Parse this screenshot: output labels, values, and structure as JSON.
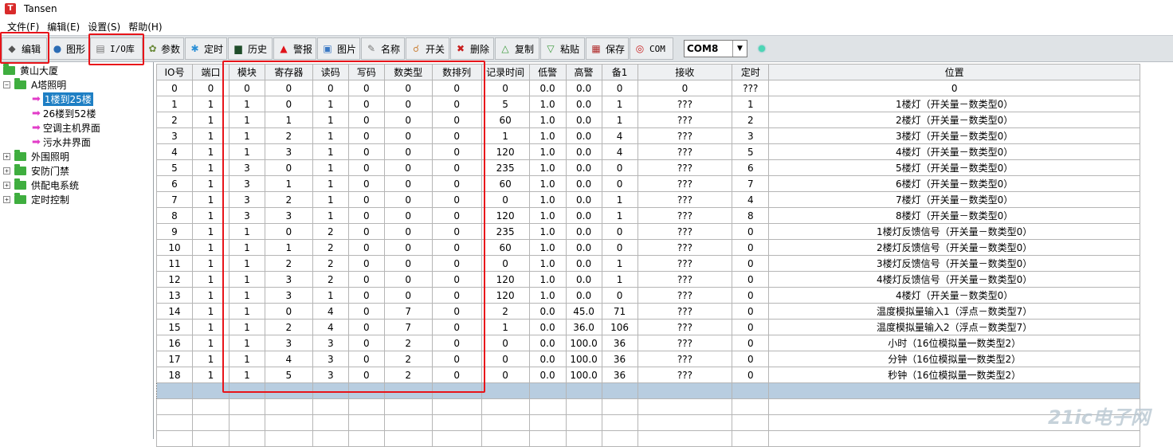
{
  "app": {
    "title": "Tansen",
    "icon_letter": "T"
  },
  "menu": [
    "文件(F)",
    "编辑(E)",
    "设置(S)",
    "帮助(H)"
  ],
  "toolbar": {
    "buttons": [
      {
        "label": "编辑",
        "icon": "edit-icon"
      },
      {
        "label": "图形",
        "icon": "graph-icon"
      },
      {
        "label": "I/O库",
        "icon": "io-library-icon"
      },
      {
        "label": "参数",
        "icon": "gear-icon"
      },
      {
        "label": "定时",
        "icon": "timer-icon"
      },
      {
        "label": "历史",
        "icon": "history-icon"
      },
      {
        "label": "警报",
        "icon": "alarm-icon"
      },
      {
        "label": "图片",
        "icon": "picture-icon"
      },
      {
        "label": "名称",
        "icon": "name-icon"
      },
      {
        "label": "开关",
        "icon": "switch-icon"
      },
      {
        "label": "删除",
        "icon": "delete-icon"
      },
      {
        "label": "复制",
        "icon": "copy-icon"
      },
      {
        "label": "粘贴",
        "icon": "paste-icon"
      },
      {
        "label": "保存",
        "icon": "save-icon"
      },
      {
        "label": "COM",
        "icon": "com-icon"
      }
    ],
    "com_port": "COM8",
    "status_color": "#4cd6b4"
  },
  "tree": {
    "root": "黄山大厦",
    "group_a": "A塔照明",
    "children": [
      "1楼到25楼",
      "26楼到52楼",
      "空调主机界面",
      "污水井界面"
    ],
    "selected": "1楼到25楼",
    "others": [
      "外围照明",
      "安防门禁",
      "供配电系统",
      "定时控制"
    ]
  },
  "table": {
    "headers": [
      "IO号",
      "端口",
      "模块",
      "寄存器",
      "读码",
      "写码",
      "数类型",
      "数排列",
      "记录时间",
      "低警",
      "高警",
      "备1",
      "接收",
      "定时",
      "位置"
    ],
    "rows": [
      [
        "0",
        "0",
        "0",
        "0",
        "0",
        "0",
        "0",
        "0",
        "0",
        "0.0",
        "0.0",
        "0",
        "0",
        "???",
        "0"
      ],
      [
        "1",
        "1",
        "1",
        "0",
        "1",
        "0",
        "0",
        "0",
        "5",
        "1.0",
        "0.0",
        "1",
        "???",
        "1",
        "1楼灯（开关量－数类型0）"
      ],
      [
        "2",
        "1",
        "1",
        "1",
        "1",
        "0",
        "0",
        "0",
        "60",
        "1.0",
        "0.0",
        "1",
        "???",
        "2",
        "2楼灯（开关量－数类型0）"
      ],
      [
        "3",
        "1",
        "1",
        "2",
        "1",
        "0",
        "0",
        "0",
        "1",
        "1.0",
        "0.0",
        "4",
        "???",
        "3",
        "3楼灯（开关量－数类型0）"
      ],
      [
        "4",
        "1",
        "1",
        "3",
        "1",
        "0",
        "0",
        "0",
        "120",
        "1.0",
        "0.0",
        "4",
        "???",
        "5",
        "4楼灯（开关量－数类型0）"
      ],
      [
        "5",
        "1",
        "3",
        "0",
        "1",
        "0",
        "0",
        "0",
        "235",
        "1.0",
        "0.0",
        "0",
        "???",
        "6",
        "5楼灯（开关量－数类型0）"
      ],
      [
        "6",
        "1",
        "3",
        "1",
        "1",
        "0",
        "0",
        "0",
        "60",
        "1.0",
        "0.0",
        "0",
        "???",
        "7",
        "6楼灯（开关量－数类型0）"
      ],
      [
        "7",
        "1",
        "3",
        "2",
        "1",
        "0",
        "0",
        "0",
        "0",
        "1.0",
        "0.0",
        "1",
        "???",
        "4",
        "7楼灯（开关量－数类型0）"
      ],
      [
        "8",
        "1",
        "3",
        "3",
        "1",
        "0",
        "0",
        "0",
        "120",
        "1.0",
        "0.0",
        "1",
        "???",
        "8",
        "8楼灯（开关量－数类型0）"
      ],
      [
        "9",
        "1",
        "1",
        "0",
        "2",
        "0",
        "0",
        "0",
        "235",
        "1.0",
        "0.0",
        "0",
        "???",
        "0",
        "1楼灯反馈信号（开关量－数类型0）"
      ],
      [
        "10",
        "1",
        "1",
        "1",
        "2",
        "0",
        "0",
        "0",
        "60",
        "1.0",
        "0.0",
        "0",
        "???",
        "0",
        "2楼灯反馈信号（开关量－数类型0）"
      ],
      [
        "11",
        "1",
        "1",
        "2",
        "2",
        "0",
        "0",
        "0",
        "0",
        "1.0",
        "0.0",
        "1",
        "???",
        "0",
        "3楼灯反馈信号（开关量－数类型0）"
      ],
      [
        "12",
        "1",
        "1",
        "3",
        "2",
        "0",
        "0",
        "0",
        "120",
        "1.0",
        "0.0",
        "1",
        "???",
        "0",
        "4楼灯反馈信号（开关量－数类型0）"
      ],
      [
        "13",
        "1",
        "1",
        "3",
        "1",
        "0",
        "0",
        "0",
        "120",
        "1.0",
        "0.0",
        "0",
        "???",
        "0",
        "4楼灯（开关量－数类型0）"
      ],
      [
        "14",
        "1",
        "1",
        "0",
        "4",
        "0",
        "7",
        "0",
        "2",
        "0.0",
        "45.0",
        "71",
        "???",
        "0",
        "温度模拟量输入1（浮点－数类型7）"
      ],
      [
        "15",
        "1",
        "1",
        "2",
        "4",
        "0",
        "7",
        "0",
        "1",
        "0.0",
        "36.0",
        "106",
        "???",
        "0",
        "温度模拟量输入2（浮点－数类型7）"
      ],
      [
        "16",
        "1",
        "1",
        "3",
        "3",
        "0",
        "2",
        "0",
        "0",
        "0.0",
        "100.0",
        "36",
        "???",
        "0",
        "小时（16位模拟量一数类型2）"
      ],
      [
        "17",
        "1",
        "1",
        "4",
        "3",
        "0",
        "2",
        "0",
        "0",
        "0.0",
        "100.0",
        "36",
        "???",
        "0",
        "分钟（16位模拟量一数类型2）"
      ],
      [
        "18",
        "1",
        "1",
        "5",
        "3",
        "0",
        "2",
        "0",
        "0",
        "0.0",
        "100.0",
        "36",
        "???",
        "0",
        "秒钟（16位模拟量一数类型2）"
      ]
    ]
  },
  "watermark": "21ic电子网"
}
